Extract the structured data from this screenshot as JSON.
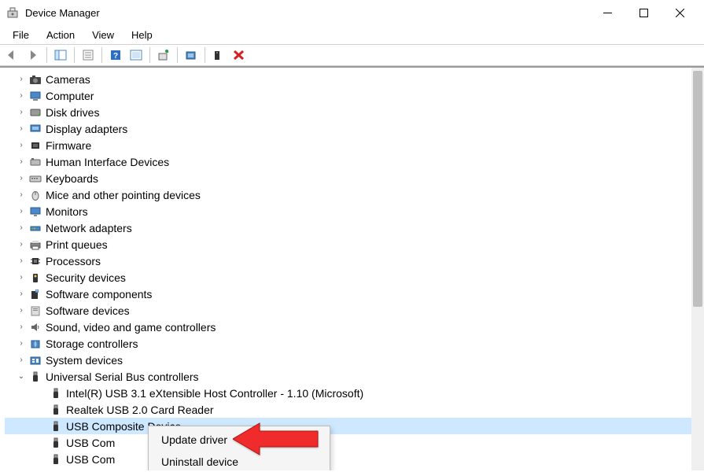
{
  "window": {
    "title": "Device Manager"
  },
  "menu": {
    "file": "File",
    "action": "Action",
    "view": "View",
    "help": "Help"
  },
  "tree": {
    "categories": [
      {
        "label": "Cameras",
        "icon": "camera"
      },
      {
        "label": "Computer",
        "icon": "computer"
      },
      {
        "label": "Disk drives",
        "icon": "disk"
      },
      {
        "label": "Display adapters",
        "icon": "display"
      },
      {
        "label": "Firmware",
        "icon": "firmware"
      },
      {
        "label": "Human Interface Devices",
        "icon": "hid"
      },
      {
        "label": "Keyboards",
        "icon": "keyboard"
      },
      {
        "label": "Mice and other pointing devices",
        "icon": "mouse"
      },
      {
        "label": "Monitors",
        "icon": "monitor"
      },
      {
        "label": "Network adapters",
        "icon": "network"
      },
      {
        "label": "Print queues",
        "icon": "printer"
      },
      {
        "label": "Processors",
        "icon": "processor"
      },
      {
        "label": "Security devices",
        "icon": "security"
      },
      {
        "label": "Software components",
        "icon": "software"
      },
      {
        "label": "Software devices",
        "icon": "software-dev"
      },
      {
        "label": "Sound, video and game controllers",
        "icon": "sound"
      },
      {
        "label": "Storage controllers",
        "icon": "storage"
      },
      {
        "label": "System devices",
        "icon": "system"
      }
    ],
    "usb_category": {
      "label": "Universal Serial Bus controllers"
    },
    "usb_children": [
      {
        "label": "Intel(R) USB 3.1 eXtensible Host Controller - 1.10 (Microsoft)"
      },
      {
        "label": "Realtek USB 2.0 Card Reader"
      },
      {
        "label": "USB Composite Device",
        "selected": true
      },
      {
        "label": "USB Com"
      },
      {
        "label": "USB Com"
      }
    ]
  },
  "context_menu": {
    "update": "Update driver",
    "uninstall": "Uninstall device"
  }
}
